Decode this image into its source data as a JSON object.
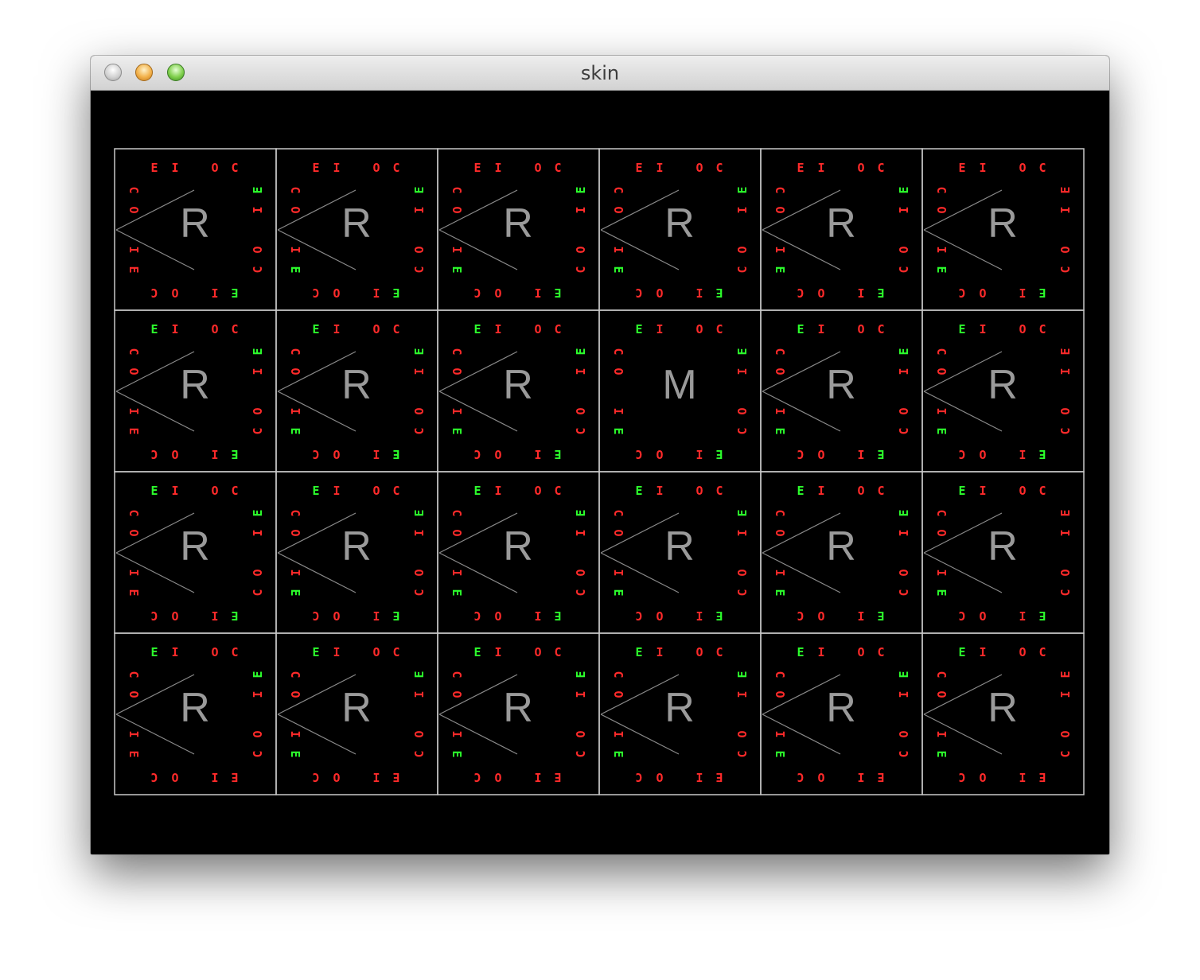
{
  "window": {
    "title": "skin",
    "controls": [
      "close-button",
      "minimize-button",
      "zoom-button"
    ]
  },
  "board": {
    "rows": 4,
    "cols": 6,
    "label_glyph": "E I O C",
    "colors": {
      "background": "#000000",
      "grid": "#c8c8c8",
      "lines": "#8a8a8a",
      "letter": "#9a9a9a",
      "red": "#ff2a2a",
      "green": "#2cff2c"
    },
    "cells": [
      [
        {
          "letter": "R",
          "v": true
        },
        {
          "letter": "R",
          "v": true
        },
        {
          "letter": "R",
          "v": true
        },
        {
          "letter": "R",
          "v": true
        },
        {
          "letter": "R",
          "v": true
        },
        {
          "letter": "R",
          "v": true
        }
      ],
      [
        {
          "letter": "R",
          "v": true
        },
        {
          "letter": "R",
          "v": true
        },
        {
          "letter": "R",
          "v": true
        },
        {
          "letter": "M",
          "v": false
        },
        {
          "letter": "R",
          "v": true
        },
        {
          "letter": "R",
          "v": true
        }
      ],
      [
        {
          "letter": "R",
          "v": true
        },
        {
          "letter": "R",
          "v": true
        },
        {
          "letter": "R",
          "v": true
        },
        {
          "letter": "R",
          "v": true
        },
        {
          "letter": "R",
          "v": true
        },
        {
          "letter": "R",
          "v": true
        }
      ],
      [
        {
          "letter": "R",
          "v": true
        },
        {
          "letter": "R",
          "v": true
        },
        {
          "letter": "R",
          "v": true
        },
        {
          "letter": "R",
          "v": true
        },
        {
          "letter": "R",
          "v": true
        },
        {
          "letter": "R",
          "v": true
        }
      ]
    ],
    "green_top_E": [
      [
        false,
        false,
        false,
        false,
        false,
        false
      ],
      [
        true,
        true,
        true,
        true,
        true,
        true
      ],
      [
        true,
        true,
        true,
        true,
        true,
        true
      ],
      [
        true,
        true,
        true,
        true,
        true,
        true
      ]
    ],
    "green_bottom_E": [
      [
        true,
        true,
        true,
        true,
        true,
        true
      ],
      [
        true,
        true,
        true,
        true,
        true,
        true
      ],
      [
        true,
        true,
        true,
        true,
        true,
        true
      ],
      [
        false,
        false,
        false,
        false,
        false,
        false
      ]
    ],
    "green_left_E": [
      [
        false,
        true,
        true,
        true,
        true,
        true
      ],
      [
        false,
        true,
        true,
        true,
        true,
        true
      ],
      [
        false,
        true,
        true,
        true,
        true,
        true
      ],
      [
        false,
        true,
        true,
        true,
        true,
        true
      ]
    ],
    "green_right_E": [
      [
        true,
        true,
        true,
        true,
        true,
        false
      ],
      [
        true,
        true,
        true,
        true,
        true,
        false
      ],
      [
        true,
        true,
        true,
        true,
        true,
        false
      ],
      [
        true,
        true,
        true,
        true,
        true,
        false
      ]
    ]
  }
}
